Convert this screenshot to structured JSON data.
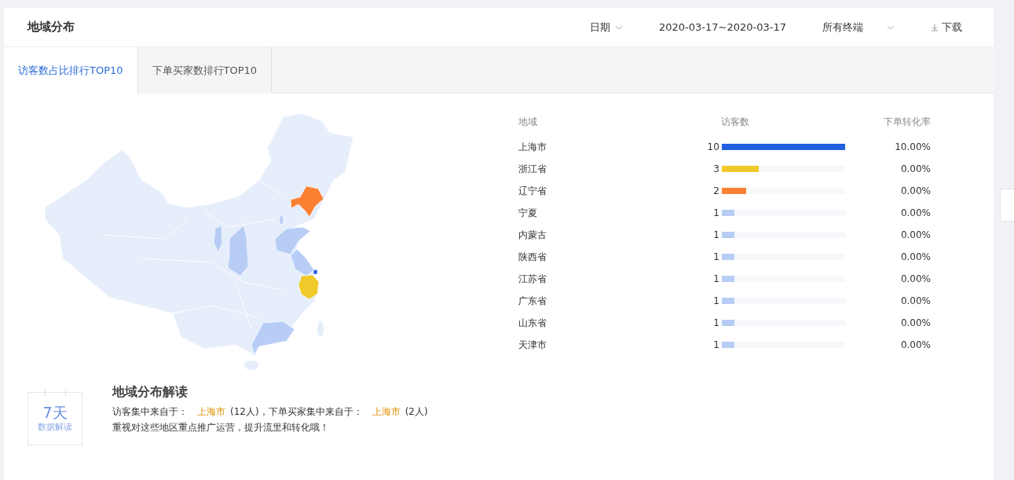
{
  "header": {
    "title": "地域分布",
    "date_label": "日期",
    "date_range": "2020-03-17~2020-03-17",
    "terminal": "所有终端",
    "download": "下载"
  },
  "tabs": [
    {
      "label": "访客数占比排行TOP10",
      "selected": true
    },
    {
      "label": "下单买家数排行TOP10",
      "selected": false
    }
  ],
  "table": {
    "columns": [
      "地域",
      "访客数",
      "下单转化率"
    ],
    "rows": [
      {
        "region": "上海市",
        "visitors": "10",
        "level": 1.0,
        "color": "#1f5fe0",
        "rate": "10.00%"
      },
      {
        "region": "浙江省",
        "visitors": "3",
        "level": 0.3,
        "color": "#f0c92a",
        "rate": "0.00%"
      },
      {
        "region": "辽宁省",
        "visitors": "2",
        "level": 0.2,
        "color": "#fb8132",
        "rate": "0.00%"
      },
      {
        "region": "宁夏",
        "visitors": "1",
        "level": 0.1,
        "color": "#b8cdf6",
        "rate": "0.00%"
      },
      {
        "region": "内蒙古",
        "visitors": "1",
        "level": 0.1,
        "color": "#b8cdf6",
        "rate": "0.00%"
      },
      {
        "region": "陕西省",
        "visitors": "1",
        "level": 0.1,
        "color": "#b8cdf6",
        "rate": "0.00%"
      },
      {
        "region": "江苏省",
        "visitors": "1",
        "level": 0.1,
        "color": "#b8cdf6",
        "rate": "0.00%"
      },
      {
        "region": "广东省",
        "visitors": "1",
        "level": 0.1,
        "color": "#b8cdf6",
        "rate": "0.00%"
      },
      {
        "region": "山东省",
        "visitors": "1",
        "level": 0.1,
        "color": "#b8cdf6",
        "rate": "0.00%"
      },
      {
        "region": "天津市",
        "visitors": "1",
        "level": 0.1,
        "color": "#b8cdf6",
        "rate": "0.00%"
      }
    ]
  },
  "insight": {
    "badge_number": "7天",
    "badge_label": "数据解读",
    "title": "地域分布解读",
    "line_1": [
      {
        "kind": "text",
        "text": "访客集中来自于："
      },
      {
        "kind": "highlight",
        "text": "上海市"
      },
      {
        "kind": "text",
        "text": "(12人)，下单买家集中来自于："
      },
      {
        "kind": "highlight",
        "text": "上海市"
      },
      {
        "kind": "text",
        "text": "(2人)"
      }
    ],
    "line_2": "重视对这些地区重点推广运营，提升流里和转化哦！"
  }
}
